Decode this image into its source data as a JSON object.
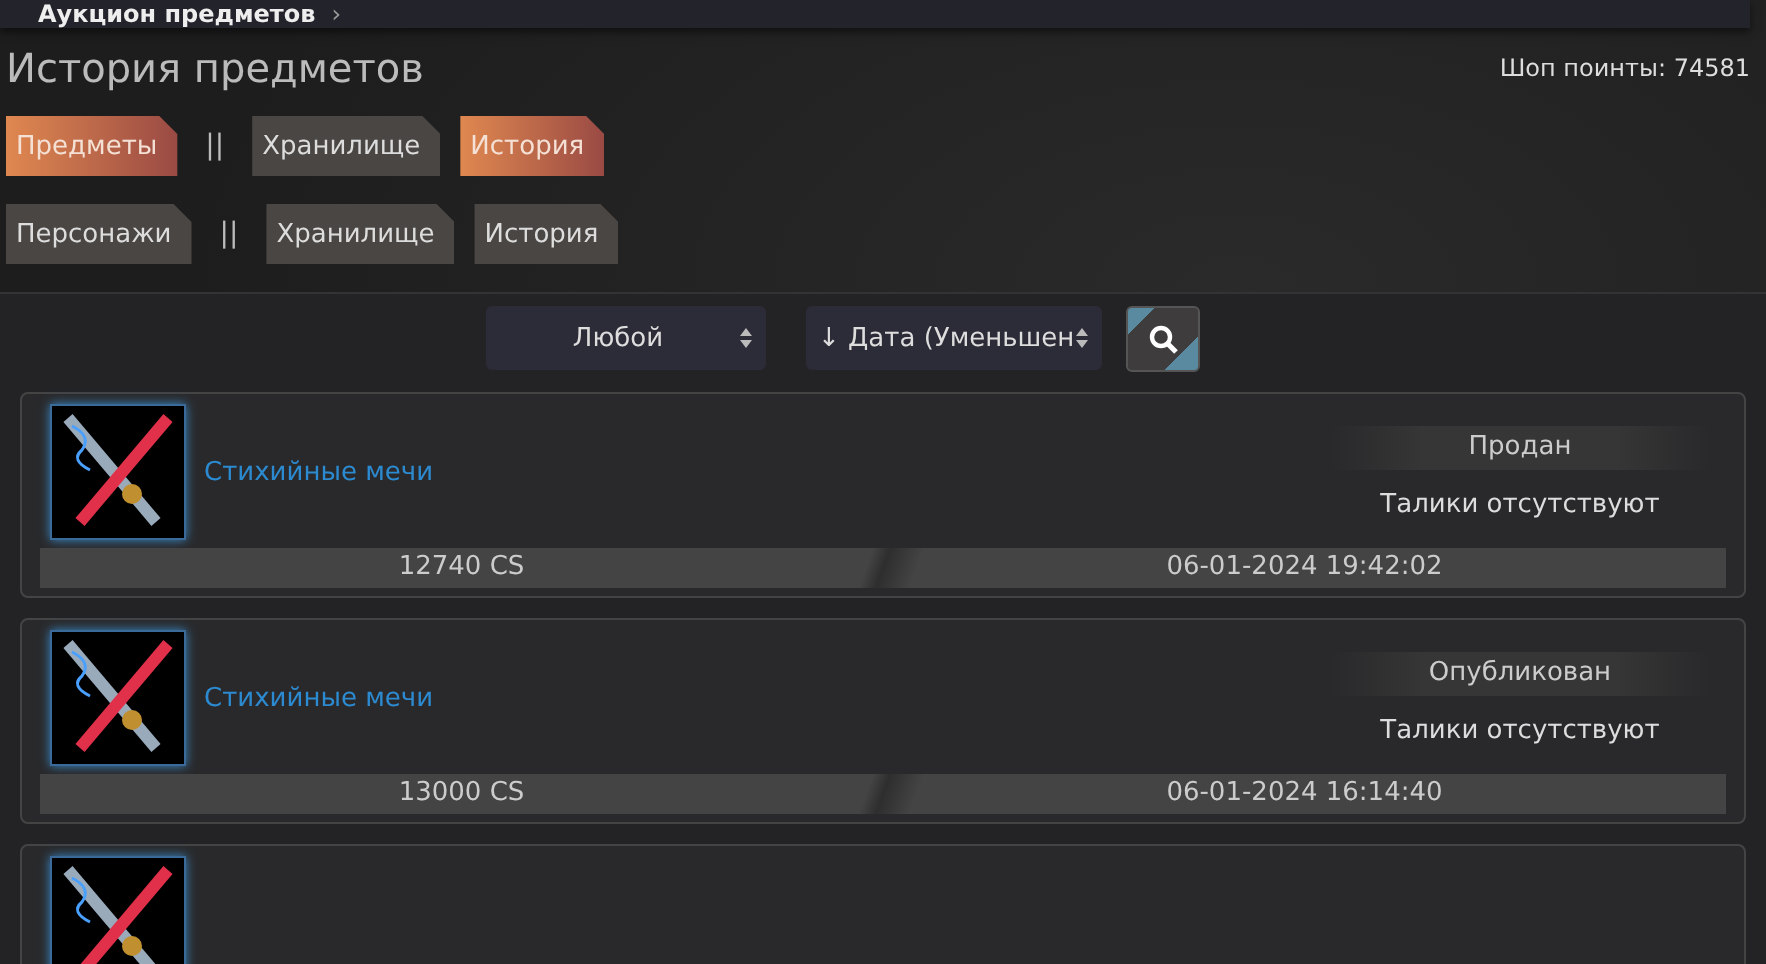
{
  "breadcrumb": {
    "label": "Аукцион предметов",
    "chevron": "›"
  },
  "page": {
    "title": "История предметов",
    "points": "Шоп поинты: 74581"
  },
  "nav_rows": [
    {
      "items": [
        {
          "kind": "tab",
          "label": "Предметы",
          "selected": true
        },
        {
          "kind": "separator",
          "label": "||"
        },
        {
          "kind": "tab",
          "label": "Хранилище",
          "selected": false
        },
        {
          "kind": "tab",
          "label": "История",
          "selected": true
        }
      ]
    },
    {
      "items": [
        {
          "kind": "tab",
          "label": "Персонажи",
          "selected": false
        },
        {
          "kind": "separator",
          "label": "||"
        },
        {
          "kind": "tab",
          "label": "Хранилище",
          "selected": false
        },
        {
          "kind": "tab",
          "label": "История",
          "selected": false
        }
      ]
    }
  ],
  "filters": {
    "type_select": "Любой",
    "sort_select": "↓ Дата (Уменьшен"
  },
  "items": [
    {
      "name": "Стихийные мечи",
      "status": "Продан",
      "taliks": "Талики отсутствуют",
      "price": "12740 CS",
      "date": "06-01-2024 19:42:02"
    },
    {
      "name": "Стихийные мечи",
      "status": "Опубликован",
      "taliks": "Талики отсутствуют",
      "price": "13000 CS",
      "date": "06-01-2024 16:14:40"
    }
  ]
}
